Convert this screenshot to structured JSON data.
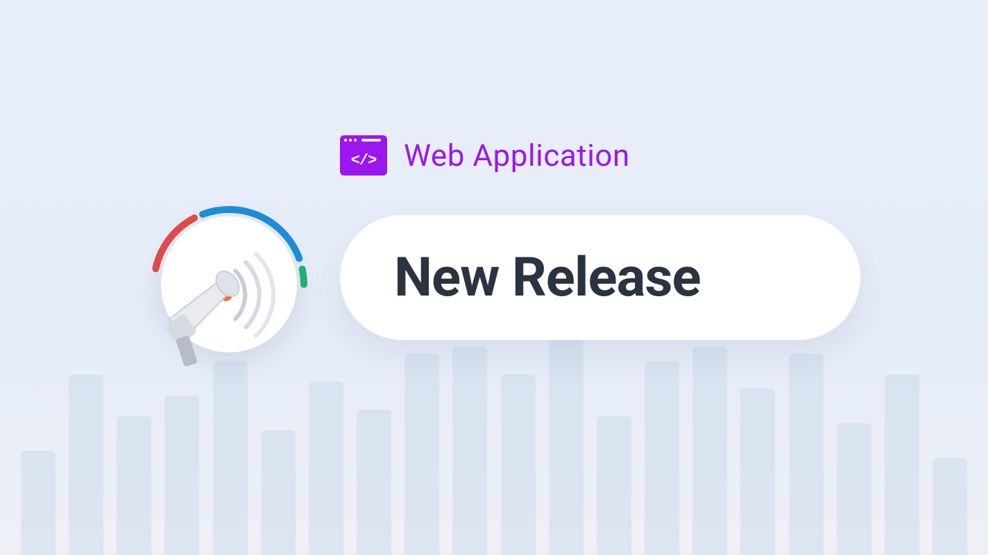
{
  "header": {
    "label": "Web Application"
  },
  "pill": {
    "title": "New Release"
  },
  "colors": {
    "accent_purple": "#9a17f0",
    "text_dark": "#2a3440",
    "ring_blue": "#1f8fd6",
    "ring_red": "#e44b4b",
    "ring_green": "#1fb47a"
  },
  "icons": {
    "code_window": "code-window-icon",
    "megaphone": "megaphone-icon"
  }
}
